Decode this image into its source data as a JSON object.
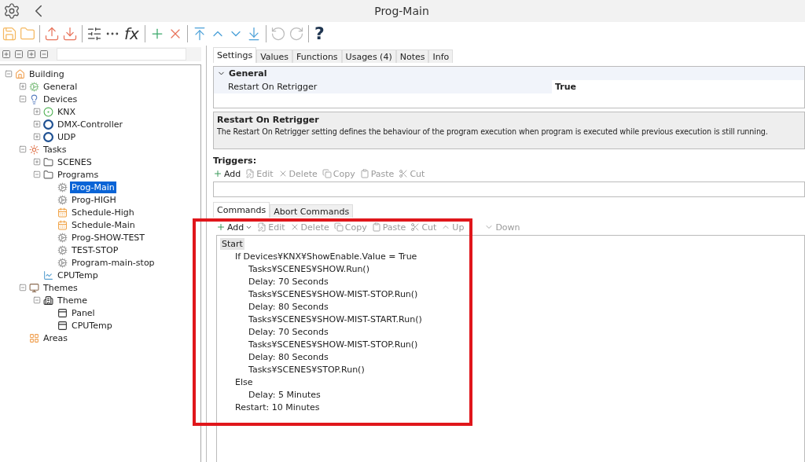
{
  "window": {
    "title": "Prog-Main"
  },
  "toolbar": {
    "formula_label": "fx",
    "help_label": "?"
  },
  "tree": [
    {
      "label": "Building",
      "kind": "home",
      "expanded": true,
      "selected": false,
      "children": [
        {
          "label": "General",
          "kind": "gear",
          "expanded": false,
          "selected": false
        },
        {
          "label": "Devices",
          "kind": "bulb",
          "expanded": true,
          "selected": false,
          "children": [
            {
              "label": "KNX",
              "kind": "knx",
              "expanded": false,
              "selected": false
            },
            {
              "label": "DMX-Controller",
              "kind": "device",
              "expanded": false,
              "selected": false
            },
            {
              "label": "UDP",
              "kind": "device",
              "expanded": false,
              "selected": false
            }
          ]
        },
        {
          "label": "Tasks",
          "kind": "task",
          "expanded": true,
          "selected": false,
          "children": [
            {
              "label": "SCENES",
              "kind": "folder",
              "expanded": false,
              "selected": false
            },
            {
              "label": "Programs",
              "kind": "folder",
              "expanded": true,
              "selected": false,
              "children": [
                {
                  "label": "Prog-Main",
                  "kind": "program",
                  "selected": true
                },
                {
                  "label": "Prog-HIGH",
                  "kind": "program",
                  "selected": false
                },
                {
                  "label": "Schedule-High",
                  "kind": "calendar",
                  "selected": false
                },
                {
                  "label": "Schedule-Main",
                  "kind": "calendar",
                  "selected": false
                },
                {
                  "label": "Prog-SHOW-TEST",
                  "kind": "program",
                  "selected": false
                },
                {
                  "label": "TEST-STOP",
                  "kind": "program",
                  "selected": false
                },
                {
                  "label": "Program-main-stop",
                  "kind": "program",
                  "selected": false
                }
              ]
            },
            {
              "label": "CPUTemp",
              "kind": "chart",
              "selected": false
            }
          ]
        },
        {
          "label": "Themes",
          "kind": "theme",
          "expanded": true,
          "selected": false,
          "children": [
            {
              "label": "Theme",
              "kind": "building",
              "expanded": true,
              "selected": false,
              "children": [
                {
                  "label": "Panel",
                  "kind": "panel",
                  "selected": false
                },
                {
                  "label": "CPUTemp",
                  "kind": "panel",
                  "selected": false
                }
              ]
            }
          ]
        },
        {
          "label": "Areas",
          "kind": "areas",
          "selected": false
        }
      ]
    }
  ],
  "tabs": [
    {
      "label": "Settings",
      "selected": true
    },
    {
      "label": "Values",
      "selected": false
    },
    {
      "label": "Functions",
      "selected": false
    },
    {
      "label": "Usages (4)",
      "selected": false
    },
    {
      "label": "Notes",
      "selected": false
    },
    {
      "label": "Info",
      "selected": false
    }
  ],
  "properties": {
    "category": "General",
    "expanded": true,
    "rows": [
      {
        "name": "Restart On Retrigger",
        "value": "True"
      }
    ]
  },
  "description": {
    "title": "Restart On Retrigger",
    "text": "The Restart On Retrigger setting defines the behaviour of the program execution when program is executed while previous execution is still running."
  },
  "triggers": {
    "label": "Triggers:",
    "actions": [
      {
        "label": "Add",
        "kind": "add",
        "disabled": false
      },
      {
        "label": "Edit",
        "kind": "edit",
        "disabled": true
      },
      {
        "label": "Delete",
        "kind": "delete",
        "disabled": true
      },
      {
        "label": "Copy",
        "kind": "copy",
        "disabled": true
      },
      {
        "label": "Paste",
        "kind": "paste",
        "disabled": true
      },
      {
        "label": "Cut",
        "kind": "cut",
        "disabled": true
      }
    ]
  },
  "command_tabs": [
    {
      "label": "Commands",
      "selected": true
    },
    {
      "label": "Abort Commands",
      "selected": false
    }
  ],
  "command_actions": [
    {
      "label": "Add",
      "kind": "add",
      "disabled": false
    },
    {
      "label": "Edit",
      "kind": "edit",
      "disabled": true
    },
    {
      "label": "Delete",
      "kind": "delete",
      "disabled": true
    },
    {
      "label": "Copy",
      "kind": "copy",
      "disabled": true
    },
    {
      "label": "Paste",
      "kind": "paste",
      "disabled": true
    },
    {
      "label": "Cut",
      "kind": "cut",
      "disabled": true
    },
    {
      "label": "Up",
      "kind": "up",
      "disabled": true
    },
    {
      "label": "Down",
      "kind": "down",
      "disabled": true
    }
  ],
  "commands": [
    {
      "label": "Start",
      "selected": true,
      "children": [
        {
          "label": "If Devices¥KNX¥ShowEnable.Value = True",
          "selected": false,
          "children": [
            {
              "label": "Tasks¥SCENES¥SHOW.Run()",
              "selected": false
            },
            {
              "label": "Delay: 70 Seconds",
              "selected": false
            },
            {
              "label": "Tasks¥SCENES¥SHOW-MIST-STOP.Run()",
              "selected": false
            },
            {
              "label": "Delay: 80 Seconds",
              "selected": false
            },
            {
              "label": "Tasks¥SCENES¥SHOW-MIST-START.Run()",
              "selected": false
            },
            {
              "label": "Delay: 70 Seconds",
              "selected": false
            },
            {
              "label": "Tasks¥SCENES¥SHOW-MIST-STOP.Run()",
              "selected": false
            },
            {
              "label": "Delay: 80 Seconds",
              "selected": false
            },
            {
              "label": "Tasks¥SCENES¥STOP.Run()",
              "selected": false
            }
          ]
        },
        {
          "label": "Else",
          "selected": false,
          "children": [
            {
              "label": "Delay: 5 Minutes",
              "selected": false
            }
          ]
        },
        {
          "label": "Restart: 10 Minutes",
          "selected": false
        }
      ]
    }
  ],
  "highlight_frame": {
    "kind": "frame"
  }
}
